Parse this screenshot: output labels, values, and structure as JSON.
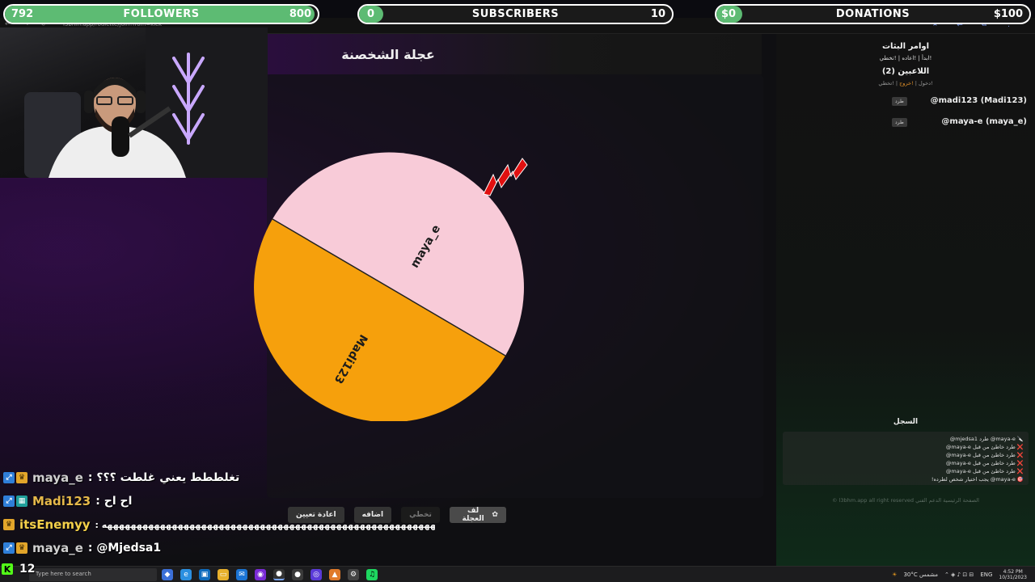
{
  "goals": {
    "followers": {
      "current": "792",
      "label": "FOLLOWERS",
      "target": "800",
      "progress": 0.99
    },
    "subscribers": {
      "current": "0",
      "label": "SUBSCRIBERS",
      "target": "10",
      "progress": 0
    },
    "donations": {
      "current": "$0",
      "label": "DONATIONS",
      "target": "$100",
      "progress": 0
    }
  },
  "browser": {
    "url": "l3bhm.app/roulette/join?from=kick",
    "nav_icons": "← → ⟳",
    "right_icons": "★ ⇄ ⧉ ⋮"
  },
  "game": {
    "title": "عجلة الشخصنة",
    "wheel_segments": [
      {
        "label": "maya_e",
        "color": "#f8cbd8"
      },
      {
        "label": "Madi123",
        "color": "#f6a00c"
      }
    ],
    "buttons": {
      "spin": "لف العجلة",
      "skip": "تخطي",
      "add": "اضافه",
      "reset": "اعادة تعيين"
    }
  },
  "sidebar": {
    "commands_title": "اوامر البثات",
    "commands": "!ابدأ | !اعاده | !تخطي",
    "players_title": "اللاعبين (2)",
    "join_hint_a": "!دخول",
    "join_hint_b": "!خروج",
    "join_hint_c": "!تخطي",
    "kick_label": "طرد",
    "players": [
      {
        "name": "@madi123 (Madi123)"
      },
      {
        "name": "@maya-e (maya_e)"
      }
    ],
    "log_title": "السجل",
    "log": [
      "🔪 maya-e@ طرد mjedsa1@",
      "❌ طرد خاطئ من قبل maya-e@",
      "❌ طرد خاطئ من قبل maya-e@",
      "❌ طرد خاطئ من قبل maya-e@",
      "❌ طرد خاطئ من قبل maya-e@",
      "🎯 maya-e@ يجب اختيار شخص لطرده!"
    ],
    "footer": "الصفحة الرئيسية   الدعم الفني   l3bhm.app all right reserved ©"
  },
  "chat": [
    {
      "user": "maya_e",
      "color": "#cfcfcf",
      "badges": [
        "blue",
        "gold"
      ],
      "message": ": تغلططط يعني غلطت ؟؟؟"
    },
    {
      "user": "Madi123",
      "color": "#e5b84a",
      "badges": [
        "blue",
        "multi"
      ],
      "message": ": اح اح"
    },
    {
      "user": "itsEnemyy",
      "color": "#f3d04a",
      "badges": [
        "gold"
      ],
      "message": ": ههههههههههههههههههههههههههههههههههههههههههههههههههههههههههههههههههههههههه"
    },
    {
      "user": "maya_e",
      "color": "#cfcfcf",
      "badges": [
        "blue",
        "gold"
      ],
      "message": ": @Mjedsa1"
    }
  ],
  "viewers": {
    "count": "12",
    "platform_icon": "K"
  },
  "taskbar": {
    "search_placeholder": "Type here to search",
    "weather": "30°C  مشمس",
    "lang": "ENG",
    "time": "4:52 PM",
    "date": "10/31/2023"
  }
}
